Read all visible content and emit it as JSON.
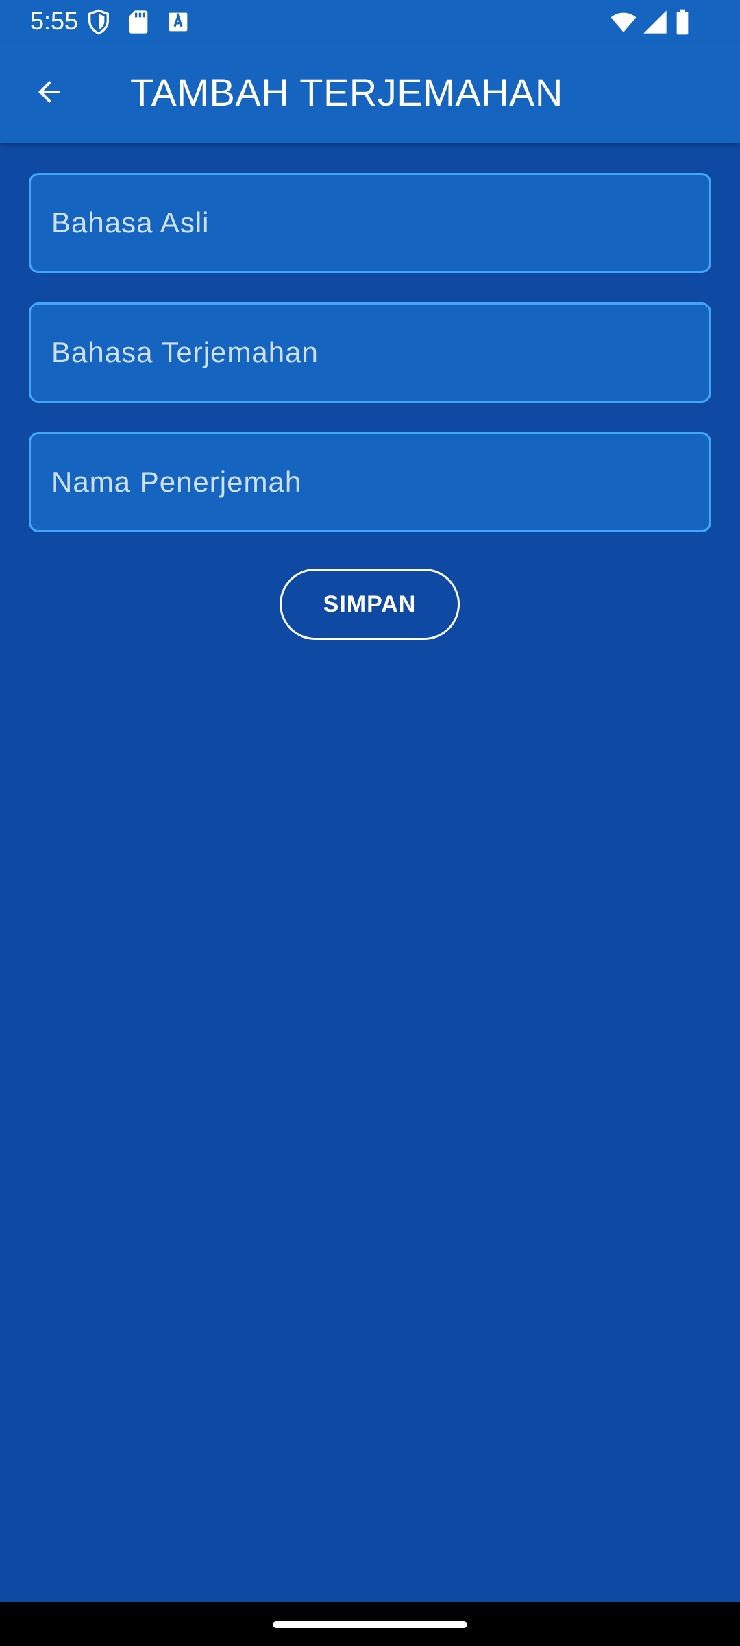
{
  "status_bar": {
    "time": "5:55",
    "icons_left": [
      "shield-icon",
      "sd-card-icon",
      "keyboard-a-icon"
    ],
    "icons_right": [
      "wifi-icon",
      "signal-icon",
      "battery-icon"
    ]
  },
  "app_bar": {
    "title": "TAMBAH TERJEMAHAN",
    "back_icon": "arrow-back-icon"
  },
  "form": {
    "original_language": {
      "placeholder": "Bahasa Asli",
      "value": ""
    },
    "translation_language": {
      "placeholder": "Bahasa Terjemahan",
      "value": ""
    },
    "translator_name": {
      "placeholder": "Nama Penerjemah",
      "value": ""
    },
    "save_label": "SIMPAN"
  },
  "colors": {
    "background": "#0e4aa3",
    "app_bar": "#1565c0",
    "field_fill": "#1565c0",
    "field_border": "#42a5f5",
    "text": "#ffffff"
  }
}
